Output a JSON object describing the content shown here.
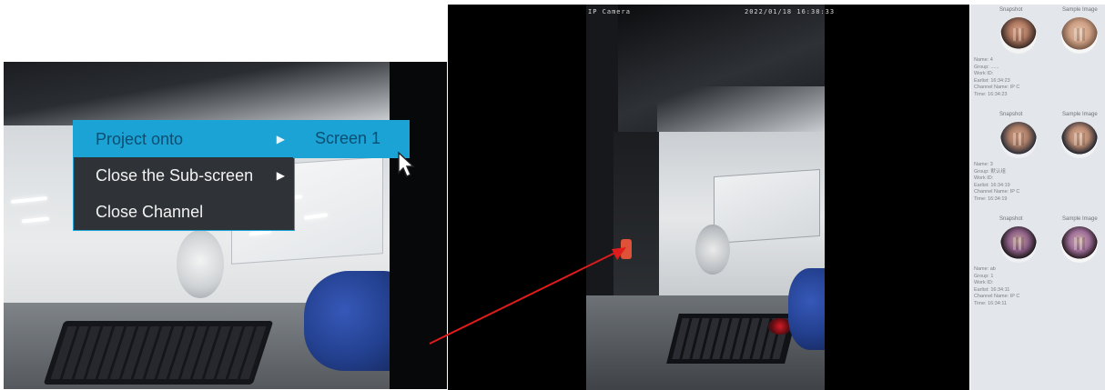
{
  "left_view": {
    "context_menu": {
      "items": [
        {
          "label": "Project onto",
          "has_submenu": true,
          "active": true
        },
        {
          "label": "Close the Sub-screen",
          "has_submenu": true,
          "active": false
        },
        {
          "label": "Close Channel",
          "has_submenu": false,
          "active": false
        }
      ],
      "submenu": {
        "items": [
          {
            "label": "Screen 1",
            "active": true
          }
        ]
      }
    }
  },
  "right_view": {
    "osd": {
      "camera_name": "IP Camera",
      "timestamp": "2022/01/18 16:38:33"
    }
  },
  "face_panel": {
    "col_snapshot": "Snapshot",
    "col_sample": "Sample Image",
    "entries": [
      {
        "name": "Name: 4",
        "group": "Group: ......",
        "work_id": "Work ID:",
        "earliest": "Earlist: 16:34:23",
        "channel": "Channel Name: IP C",
        "time": "Time: 16:34:23"
      },
      {
        "name": "Name: 3",
        "group": "Group: 默认组",
        "work_id": "Work ID:",
        "earliest": "Earlist: 16:34:19",
        "channel": "Channel Name: IP C",
        "time": "Time: 16:34:19"
      },
      {
        "name": "Name: ab",
        "group": "Group: 1",
        "work_id": "Work ID:",
        "earliest": "Earlist: 16:34:11",
        "channel": "Channel Name: IP C",
        "time": "Time: 16:34:11"
      }
    ]
  },
  "colors": {
    "menu_accent": "#1aa3d4",
    "menu_bg": "#2f3236",
    "arrow": "#e01b1b",
    "panel_bg": "#e3e7eb"
  }
}
